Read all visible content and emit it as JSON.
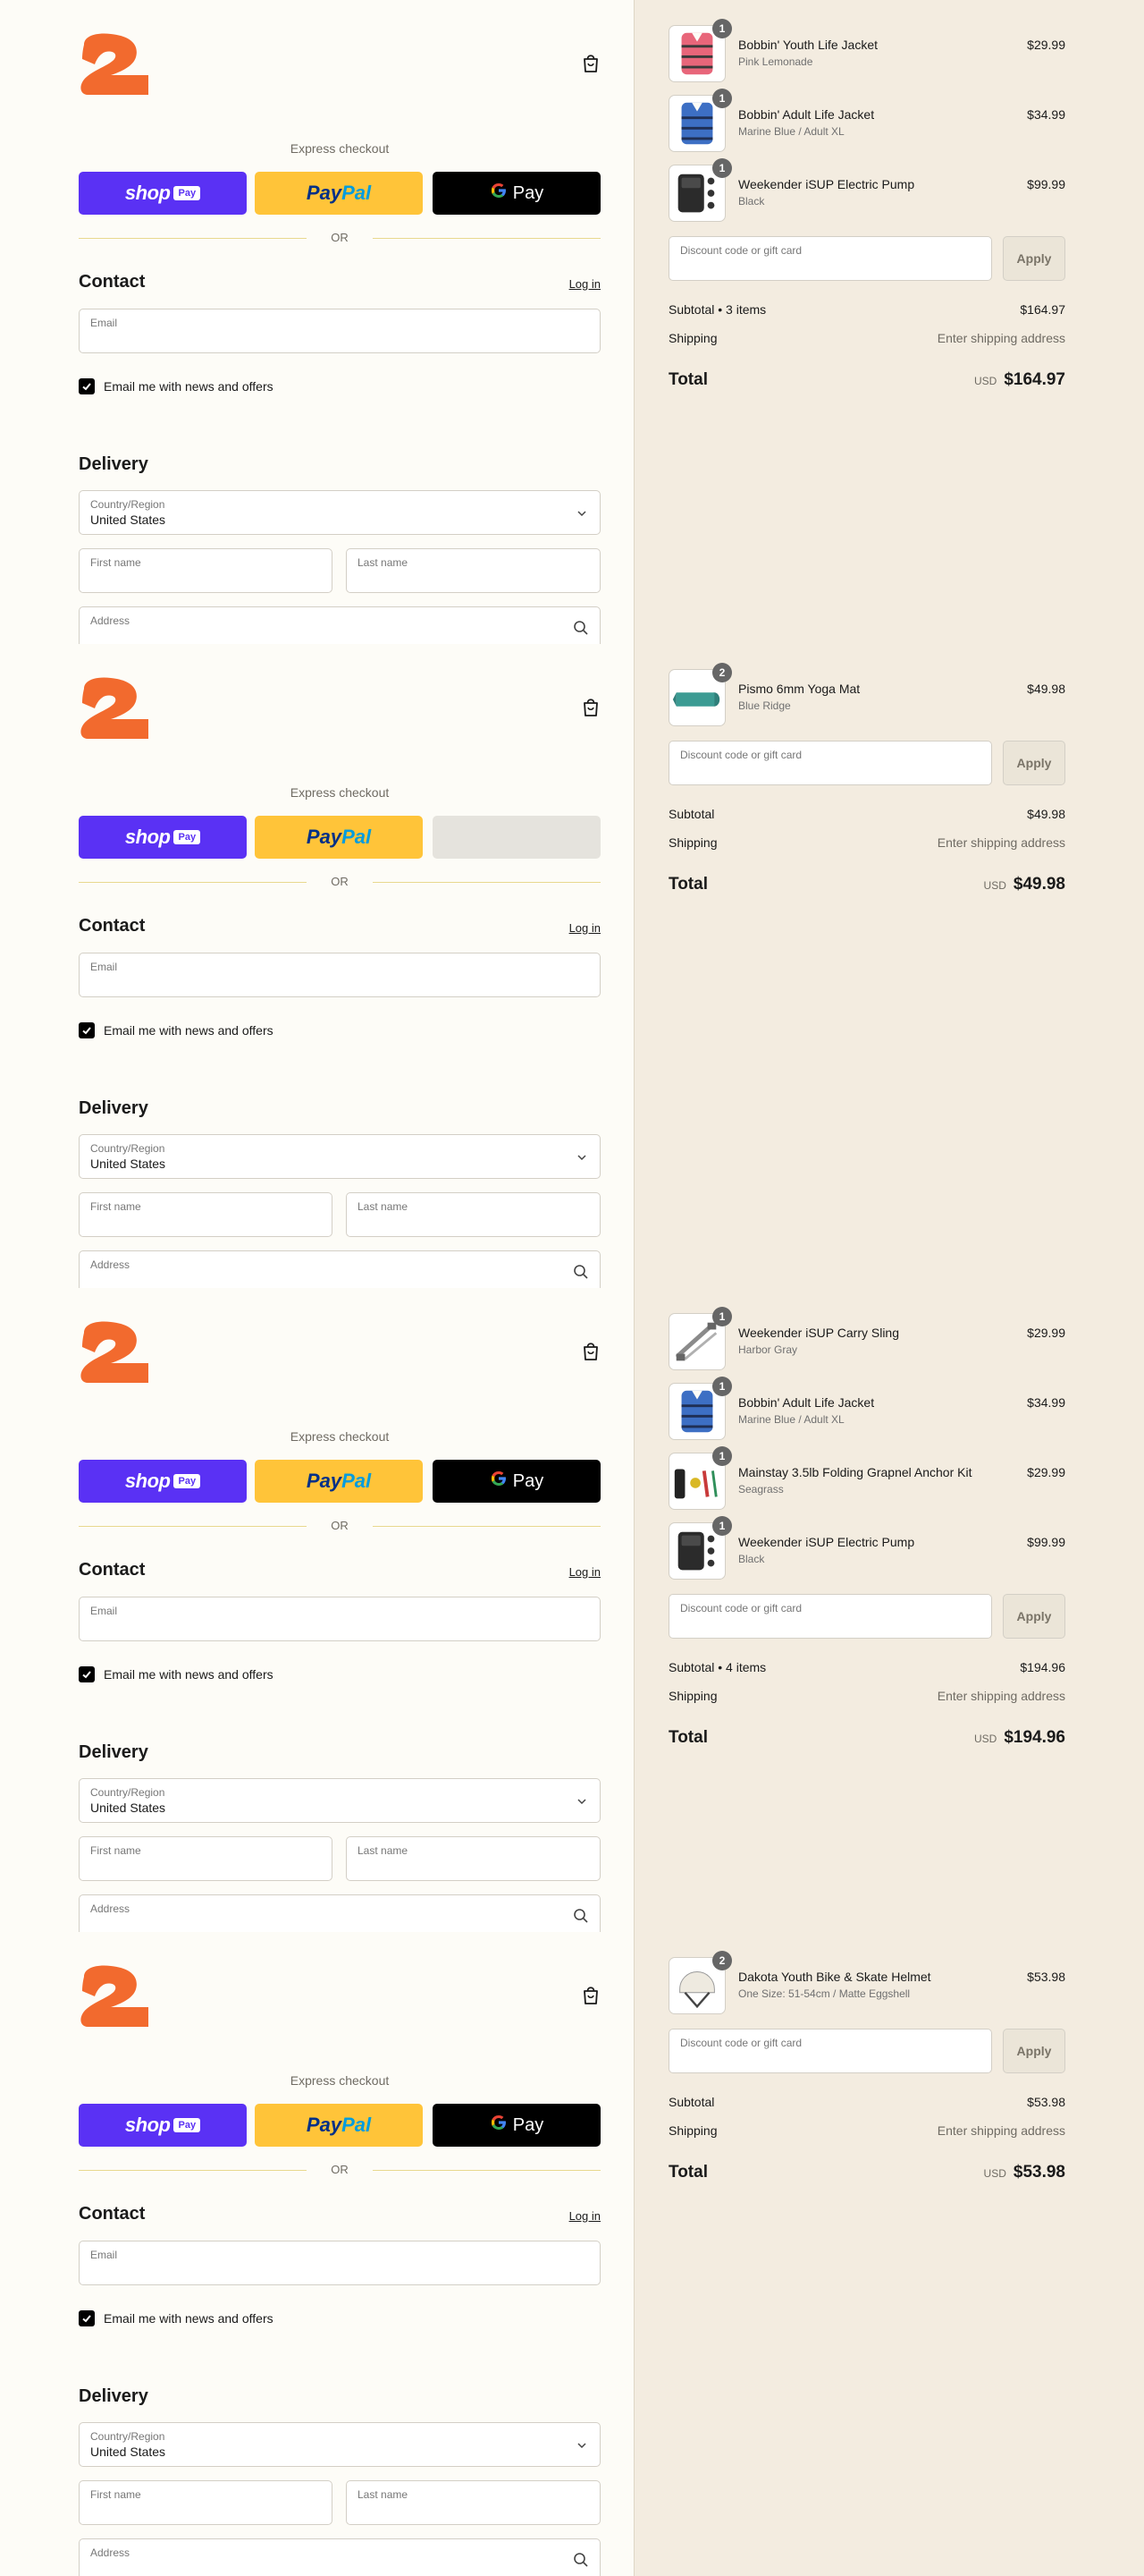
{
  "colors": {
    "brand_orange": "#f26a2e",
    "shop_purple": "#5a31f4",
    "paypal_yellow": "#ffc439",
    "gpay_black": "#000000",
    "sidebar_bg": "#f3ece0",
    "page_bg": "#fdfcf7"
  },
  "icons": {
    "logo": "brand-logo",
    "cart": "shopping-bag-icon",
    "chevron": "chevron-down-icon",
    "search": "search-icon",
    "check": "checkmark-icon"
  },
  "panels": [
    {
      "express_label": "Express checkout",
      "shop_label": "shop",
      "shop_pay_label": "Pay",
      "paypal_a": "Pay",
      "paypal_b": "Pal",
      "gpay_label": "Pay",
      "gpay_loaded": true,
      "or_label": "OR",
      "contact_title": "Contact",
      "login_label": "Log in",
      "email_label": "Email",
      "newsletter_label": "Email me with news and offers",
      "delivery_title": "Delivery",
      "country_label": "Country/Region",
      "country_value": "United States",
      "first_name_label": "First name",
      "last_name_label": "Last name",
      "address_label": "Address",
      "items": [
        {
          "name": "Bobbin' Youth Life Jacket",
          "variant": "Pink Lemonade",
          "price": "$29.99",
          "qty": "1",
          "thumb": "pink-life-jacket"
        },
        {
          "name": "Bobbin' Adult Life Jacket",
          "variant": "Marine Blue / Adult XL",
          "price": "$34.99",
          "qty": "1",
          "thumb": "blue-life-jacket"
        },
        {
          "name": "Weekender iSUP Electric Pump",
          "variant": "Black",
          "price": "$99.99",
          "qty": "1",
          "thumb": "electric-pump"
        }
      ],
      "discount_placeholder": "Discount code or gift card",
      "apply_label": "Apply",
      "subtotal_label": "Subtotal • 3 items",
      "subtotal_value": "$164.97",
      "shipping_label": "Shipping",
      "shipping_value": "Enter shipping address",
      "total_label": "Total",
      "currency": "USD",
      "total_value": "$164.97"
    },
    {
      "express_label": "Express checkout",
      "shop_label": "shop",
      "shop_pay_label": "Pay",
      "paypal_a": "Pay",
      "paypal_b": "Pal",
      "gpay_label": "",
      "gpay_loaded": false,
      "or_label": "OR",
      "contact_title": "Contact",
      "login_label": "Log in",
      "email_label": "Email",
      "newsletter_label": "Email me with news and offers",
      "delivery_title": "Delivery",
      "country_label": "Country/Region",
      "country_value": "United States",
      "first_name_label": "First name",
      "last_name_label": "Last name",
      "address_label": "Address",
      "items": [
        {
          "name": "Pismo 6mm Yoga Mat",
          "variant": "Blue Ridge",
          "price": "$49.98",
          "qty": "2",
          "thumb": "yoga-mat"
        }
      ],
      "discount_placeholder": "Discount code or gift card",
      "apply_label": "Apply",
      "subtotal_label": "Subtotal",
      "subtotal_value": "$49.98",
      "shipping_label": "Shipping",
      "shipping_value": "Enter shipping address",
      "total_label": "Total",
      "currency": "USD",
      "total_value": "$49.98"
    },
    {
      "express_label": "Express checkout",
      "shop_label": "shop",
      "shop_pay_label": "Pay",
      "paypal_a": "Pay",
      "paypal_b": "Pal",
      "gpay_label": "Pay",
      "gpay_loaded": true,
      "or_label": "OR",
      "contact_title": "Contact",
      "login_label": "Log in",
      "email_label": "Email",
      "newsletter_label": "Email me with news and offers",
      "delivery_title": "Delivery",
      "country_label": "Country/Region",
      "country_value": "United States",
      "first_name_label": "First name",
      "last_name_label": "Last name",
      "address_label": "Address",
      "items": [
        {
          "name": "Weekender iSUP Carry Sling",
          "variant": "Harbor Gray",
          "price": "$29.99",
          "qty": "1",
          "thumb": "carry-sling"
        },
        {
          "name": "Bobbin' Adult Life Jacket",
          "variant": "Marine Blue / Adult XL",
          "price": "$34.99",
          "qty": "1",
          "thumb": "blue-life-jacket"
        },
        {
          "name": "Mainstay 3.5lb Folding Grapnel Anchor Kit",
          "variant": "Seagrass",
          "price": "$29.99",
          "qty": "1",
          "thumb": "anchor-kit"
        },
        {
          "name": "Weekender iSUP Electric Pump",
          "variant": "Black",
          "price": "$99.99",
          "qty": "1",
          "thumb": "electric-pump"
        }
      ],
      "discount_placeholder": "Discount code or gift card",
      "apply_label": "Apply",
      "subtotal_label": "Subtotal • 4 items",
      "subtotal_value": "$194.96",
      "shipping_label": "Shipping",
      "shipping_value": "Enter shipping address",
      "total_label": "Total",
      "currency": "USD",
      "total_value": "$194.96"
    },
    {
      "express_label": "Express checkout",
      "shop_label": "shop",
      "shop_pay_label": "Pay",
      "paypal_a": "Pay",
      "paypal_b": "Pal",
      "gpay_label": "Pay",
      "gpay_loaded": true,
      "or_label": "OR",
      "contact_title": "Contact",
      "login_label": "Log in",
      "email_label": "Email",
      "newsletter_label": "Email me with news and offers",
      "delivery_title": "Delivery",
      "country_label": "Country/Region",
      "country_value": "United States",
      "first_name_label": "First name",
      "last_name_label": "Last name",
      "address_label": "Address",
      "items": [
        {
          "name": "Dakota Youth Bike & Skate Helmet",
          "variant": "One Size: 51-54cm / Matte Eggshell",
          "price": "$53.98",
          "qty": "2",
          "thumb": "helmet"
        }
      ],
      "discount_placeholder": "Discount code or gift card",
      "apply_label": "Apply",
      "subtotal_label": "Subtotal",
      "subtotal_value": "$53.98",
      "shipping_label": "Shipping",
      "shipping_value": "Enter shipping address",
      "total_label": "Total",
      "currency": "USD",
      "total_value": "$53.98"
    }
  ]
}
